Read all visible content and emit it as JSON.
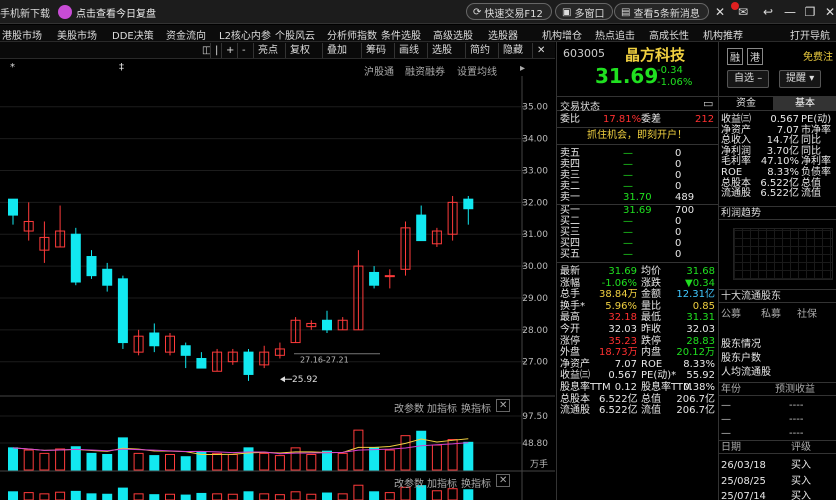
{
  "titlebar": {
    "left_text": "手机新下载",
    "promo": "点击查看今日复盘",
    "quick_trade": "快速交易F12",
    "multi_window": "多窗口",
    "news": "查看5条新消息"
  },
  "menubar": {
    "items": [
      "港股市场",
      "美股市场",
      "DDE决策",
      "资金流向",
      "L2核心内参",
      "个股风云",
      "分析师指数",
      "条件选股",
      "高级选股",
      "选股器",
      "机构增仓",
      "热点追击",
      "高成长性",
      "机构推荐",
      "打开导航"
    ]
  },
  "chart_toolbar": {
    "items": [
      "◫",
      "|",
      "+",
      "-",
      "亮点",
      "复权",
      "叠加",
      "筹码",
      "画线",
      "选股",
      "简约",
      "隐藏"
    ]
  },
  "subtabs": [
    "沪股通",
    "融资融券",
    "设置均线"
  ],
  "chart": {
    "y_ticks": [
      "35.00",
      "34.00",
      "33.00",
      "32.00",
      "31.00",
      "30.00",
      "29.00",
      "28.00",
      "27.00"
    ],
    "range_label": "27.16-27.21",
    "low_label": "25.92",
    "vol_toolbar": [
      "改参数",
      "加指标",
      "换指标"
    ],
    "vol_ticks": [
      "97.50",
      "48.80",
      "万手"
    ],
    "bottom_toolbar": [
      "改参数",
      "加指标",
      "换指标"
    ]
  },
  "chart_data": {
    "type": "candlestick",
    "title": "",
    "ylim": [
      26.3,
      35.4
    ],
    "candles": [
      {
        "o": 32.1,
        "c": 31.6,
        "h": 32.1,
        "l": 31.3
      },
      {
        "o": 31.1,
        "c": 31.4,
        "h": 32.0,
        "l": 30.8
      },
      {
        "o": 30.5,
        "c": 30.9,
        "h": 31.4,
        "l": 30.1
      },
      {
        "o": 30.6,
        "c": 31.1,
        "h": 31.9,
        "l": 30.6
      },
      {
        "o": 31.0,
        "c": 29.5,
        "h": 31.2,
        "l": 29.4
      },
      {
        "o": 30.3,
        "c": 29.7,
        "h": 30.5,
        "l": 29.6
      },
      {
        "o": 29.9,
        "c": 29.4,
        "h": 30.1,
        "l": 29.2
      },
      {
        "o": 29.6,
        "c": 27.6,
        "h": 29.7,
        "l": 27.4
      },
      {
        "o": 27.3,
        "c": 27.8,
        "h": 28.0,
        "l": 27.2
      },
      {
        "o": 27.9,
        "c": 27.5,
        "h": 28.2,
        "l": 27.3
      },
      {
        "o": 27.3,
        "c": 27.8,
        "h": 27.9,
        "l": 27.2
      },
      {
        "o": 27.5,
        "c": 27.2,
        "h": 27.6,
        "l": 26.8
      },
      {
        "o": 27.1,
        "c": 26.8,
        "h": 27.3,
        "l": 26.8
      },
      {
        "o": 26.7,
        "c": 27.3,
        "h": 27.4,
        "l": 26.7
      },
      {
        "o": 27.0,
        "c": 27.3,
        "h": 27.4,
        "l": 26.9
      },
      {
        "o": 27.3,
        "c": 26.6,
        "h": 27.4,
        "l": 26.4
      },
      {
        "o": 26.9,
        "c": 27.3,
        "h": 27.5,
        "l": 26.8
      },
      {
        "o": 27.2,
        "c": 27.4,
        "h": 27.6,
        "l": 27.1
      },
      {
        "o": 27.6,
        "c": 28.3,
        "h": 28.4,
        "l": 27.6
      },
      {
        "o": 28.1,
        "c": 28.2,
        "h": 28.3,
        "l": 28.0
      },
      {
        "o": 28.3,
        "c": 28.0,
        "h": 28.6,
        "l": 27.9
      },
      {
        "o": 28.0,
        "c": 28.3,
        "h": 28.4,
        "l": 28.0
      },
      {
        "o": 28.0,
        "c": 30.0,
        "h": 30.5,
        "l": 28.0
      },
      {
        "o": 29.8,
        "c": 29.4,
        "h": 30.0,
        "l": 29.3
      },
      {
        "o": 29.7,
        "c": 29.7,
        "h": 29.9,
        "l": 29.3
      },
      {
        "o": 29.9,
        "c": 31.2,
        "h": 31.4,
        "l": 29.7
      },
      {
        "o": 31.6,
        "c": 30.8,
        "h": 31.9,
        "l": 30.8
      },
      {
        "o": 30.7,
        "c": 31.1,
        "h": 31.2,
        "l": 30.6
      },
      {
        "o": 31.0,
        "c": 32.0,
        "h": 32.2,
        "l": 30.8
      },
      {
        "o": 32.1,
        "c": 31.8,
        "h": 32.2,
        "l": 31.3
      }
    ],
    "volumes": [
      40,
      36,
      30,
      38,
      42,
      30,
      28,
      58,
      30,
      26,
      28,
      24,
      32,
      30,
      28,
      40,
      30,
      26,
      40,
      28,
      34,
      30,
      72,
      40,
      36,
      62,
      70,
      45,
      55,
      50
    ],
    "vol_max": 97.5
  },
  "stock": {
    "code": "603005",
    "name": "晶方科技",
    "price": "31.69",
    "change": "-0.34",
    "change_pct": "-1.06%",
    "trade_status": "交易状态",
    "weibi_label": "委比",
    "weibi_val": "17.81%",
    "weicha_label": "委差",
    "weicha_val": "212",
    "promo": "抓住机会，即刻开户！",
    "sells": [
      {
        "label": "卖五",
        "price": "—",
        "vol": "0"
      },
      {
        "label": "卖四",
        "price": "—",
        "vol": "0"
      },
      {
        "label": "卖三",
        "price": "—",
        "vol": "0"
      },
      {
        "label": "卖二",
        "price": "—",
        "vol": "0"
      },
      {
        "label": "卖一",
        "price": "31.70",
        "vol": "489"
      }
    ],
    "buys": [
      {
        "label": "买一",
        "price": "31.69",
        "vol": "700"
      },
      {
        "label": "买二",
        "price": "—",
        "vol": "0"
      },
      {
        "label": "买三",
        "price": "—",
        "vol": "0"
      },
      {
        "label": "买四",
        "price": "—",
        "vol": "0"
      },
      {
        "label": "买五",
        "price": "—",
        "vol": "0"
      }
    ],
    "stats": [
      {
        "l1": "最新",
        "v1": "31.69",
        "c1": "green",
        "l2": "均价",
        "v2": "31.68",
        "c2": "green"
      },
      {
        "l1": "涨幅",
        "v1": "-1.06%",
        "c1": "green",
        "l2": "涨跌",
        "v2": "▼0.34",
        "c2": "green"
      },
      {
        "l1": "总手",
        "v1": "38.84万",
        "c1": "yellow",
        "l2": "金额",
        "v2": "12.31亿",
        "c2": "cyan"
      },
      {
        "l1": "换手*",
        "v1": "5.96%",
        "c1": "yellow",
        "l2": "量比",
        "v2": "0.85",
        "c2": "yellow"
      },
      {
        "l1": "最高",
        "v1": "32.18",
        "c1": "red",
        "l2": "最低",
        "v2": "31.31",
        "c2": "green"
      },
      {
        "l1": "今开",
        "v1": "32.03",
        "c1": "white",
        "l2": "昨收",
        "v2": "32.03",
        "c2": "white"
      },
      {
        "l1": "涨停",
        "v1": "35.23",
        "c1": "red",
        "l2": "跌停",
        "v2": "28.83",
        "c2": "green"
      },
      {
        "l1": "外盘",
        "v1": "18.73万",
        "c1": "red",
        "l2": "内盘",
        "v2": "20.12万",
        "c2": "green"
      },
      {
        "l1": "净资产",
        "v1": "7.07",
        "c1": "white",
        "l2": "ROE",
        "v2": "8.33%",
        "c2": "white"
      },
      {
        "l1": "收益㈢",
        "v1": "0.567",
        "c1": "white",
        "l2": "PE(动)*",
        "v2": "55.92",
        "c2": "white"
      },
      {
        "l1": "股息率TTM",
        "v1": "0.12",
        "c1": "white",
        "l2": "股息率TTM",
        "v2": "0.38%",
        "c2": "white"
      },
      {
        "l1": "总股本",
        "v1": "6.522亿",
        "c1": "white",
        "l2": "总值",
        "v2": "206.7亿",
        "c2": "white"
      },
      {
        "l1": "流通股",
        "v1": "6.522亿",
        "c1": "white",
        "l2": "流值",
        "v2": "206.7亿",
        "c2": "white"
      }
    ]
  },
  "far": {
    "badges": [
      "融",
      "港"
    ],
    "free_link": "免费注",
    "select_btn": "自选",
    "alert_btn": "提醒",
    "tabs": [
      "资金",
      "基本"
    ],
    "fund": [
      {
        "l": "收益㈢",
        "v": "0.567",
        "r": "PE(动)"
      },
      {
        "l": "净资产",
        "v": "7.07",
        "r": "市净率"
      },
      {
        "l": "总收入",
        "v": "14.7亿",
        "r": "同比"
      },
      {
        "l": "净利润",
        "v": "3.70亿",
        "r": "同比"
      },
      {
        "l": "毛利率",
        "v": "47.10%",
        "r": "净利率"
      },
      {
        "l": "ROE",
        "v": "8.33%",
        "r": "负债率"
      },
      {
        "l": "总股本",
        "v": "6.522亿",
        "r": "总值"
      },
      {
        "l": "流通股",
        "v": "6.522亿",
        "r": "流值"
      }
    ],
    "profit_trend": "利润趋势",
    "top10": "十大流通股东",
    "holder_cols": [
      "公募",
      "私募",
      "社保"
    ],
    "holder_rows": [
      "股东情况",
      "股东户数",
      "人均流通股"
    ],
    "forecast_cols": [
      "年份",
      "预测收益"
    ],
    "forecast_rows": [
      "—",
      "—",
      "—"
    ],
    "forecast_vals": [
      "----",
      "----",
      "----"
    ],
    "rating_cols": [
      "日期",
      "评级"
    ],
    "ratings": [
      {
        "date": "26/03/18",
        "rating": "买入"
      },
      {
        "date": "25/08/25",
        "rating": "买入"
      },
      {
        "date": "25/07/14",
        "rating": "买入"
      }
    ]
  }
}
